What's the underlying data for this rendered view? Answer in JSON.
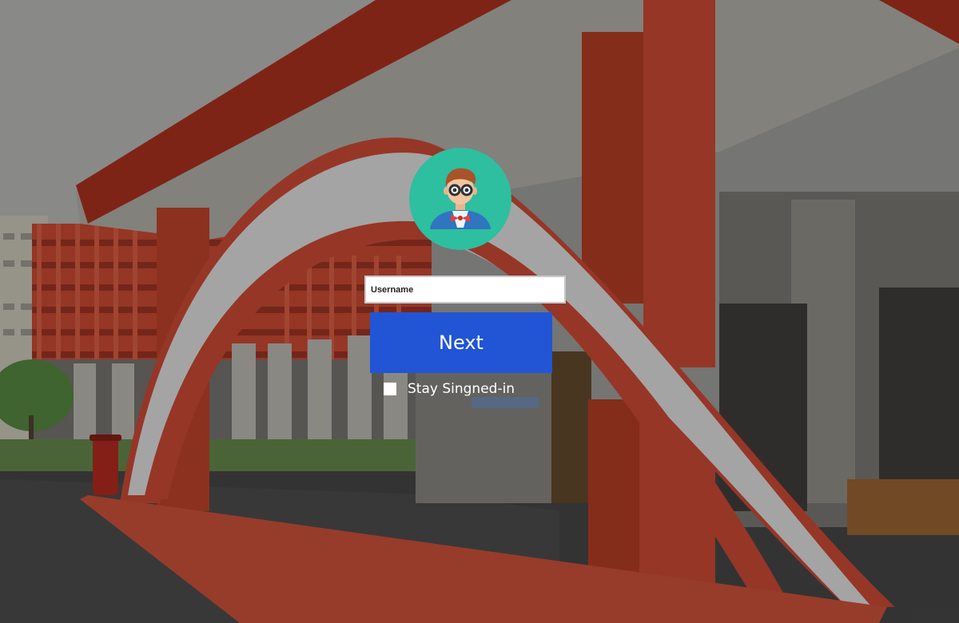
{
  "login": {
    "avatar_icon": "user-avatar-icon",
    "avatar_bg_color": "#2dbfa0",
    "username_placeholder": "Username",
    "username_value": "",
    "next_label": "Next",
    "next_color": "#2155d6",
    "stay_label": "Stay Singned-in",
    "stay_checked": false
  }
}
